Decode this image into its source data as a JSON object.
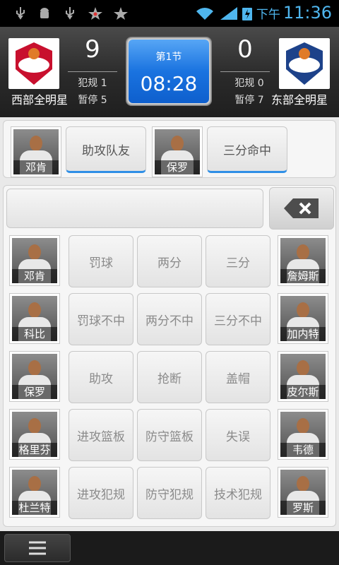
{
  "status": {
    "ampm": "下午",
    "time": "11:36"
  },
  "scoreboard": {
    "home": {
      "name": "西部全明星",
      "score": "9",
      "fouls": "犯规 1",
      "timeouts": "暂停 5"
    },
    "away": {
      "name": "东部全明星",
      "score": "0",
      "fouls": "犯规 0",
      "timeouts": "暂停 7"
    },
    "quarter": "第1节",
    "clock": "08:28"
  },
  "last_event": {
    "player1": "邓肯",
    "action1": "助攻队友",
    "player2": "保罗",
    "action2": "三分命中"
  },
  "actions": [
    "罚球",
    "两分",
    "三分",
    "罚球不中",
    "两分不中",
    "三分不中",
    "助攻",
    "抢断",
    "盖帽",
    "进攻篮板",
    "防守篮板",
    "失误",
    "进攻犯规",
    "防守犯规",
    "技术犯规"
  ],
  "west_players": [
    "邓肯",
    "科比",
    "保罗",
    "格里芬",
    "杜兰特"
  ],
  "east_players": [
    "詹姆斯",
    "加内特",
    "皮尔斯",
    "韦德",
    "罗斯"
  ],
  "colors": {
    "accent": "#2f8fe6",
    "clock": "#1a73e0",
    "time": "#4fb6ee"
  }
}
